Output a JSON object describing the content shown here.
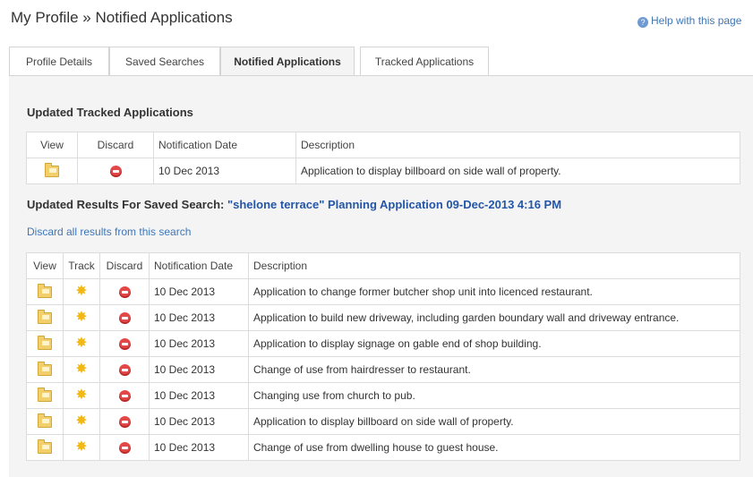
{
  "page": {
    "title": "My Profile » Notified Applications",
    "help_label": "Help with this page",
    "help_icon": "help-icon"
  },
  "tabs": [
    {
      "label": "Profile Details",
      "active": false
    },
    {
      "label": "Saved Searches",
      "active": false
    },
    {
      "label": "Notified Applications",
      "active": true
    },
    {
      "label": "Tracked Applications",
      "active": false
    }
  ],
  "tracked": {
    "title": "Updated Tracked Applications",
    "columns": {
      "view": "View",
      "discard": "Discard",
      "date": "Notification Date",
      "desc": "Description"
    },
    "rows": [
      {
        "date": "10 Dec 2013",
        "desc": "Application to display billboard on side wall of property."
      }
    ]
  },
  "saved": {
    "title_prefix": "Updated Results For Saved Search:",
    "search_name": "\"shelone terrace\" Planning Application 09-Dec-2013 4:16 PM",
    "discard_all": "Discard all results from this search",
    "columns": {
      "view": "View",
      "track": "Track",
      "discard": "Discard",
      "date": "Notification Date",
      "desc": "Description"
    },
    "rows": [
      {
        "date": "10 Dec 2013",
        "desc": "Application to change former butcher shop unit into licenced restaurant."
      },
      {
        "date": "10 Dec 2013",
        "desc": "Application to build new driveway, including garden boundary wall and driveway entrance."
      },
      {
        "date": "10 Dec 2013",
        "desc": "Application to display signage on gable end of shop building."
      },
      {
        "date": "10 Dec 2013",
        "desc": "Change of use from hairdresser to restaurant."
      },
      {
        "date": "10 Dec 2013",
        "desc": "Changing use from church to pub."
      },
      {
        "date": "10 Dec 2013",
        "desc": "Application to display billboard on side wall of property."
      },
      {
        "date": "10 Dec 2013",
        "desc": "Change of use from dwelling house to guest house."
      }
    ]
  },
  "icons": {
    "view": "folder-icon",
    "track": "star-icon",
    "discard": "discard-icon"
  },
  "colors": {
    "link": "#3f76b4",
    "search_name": "#2356a8",
    "discard": "#e34848",
    "star": "#f2b915",
    "folder": "#f2cf6a"
  }
}
